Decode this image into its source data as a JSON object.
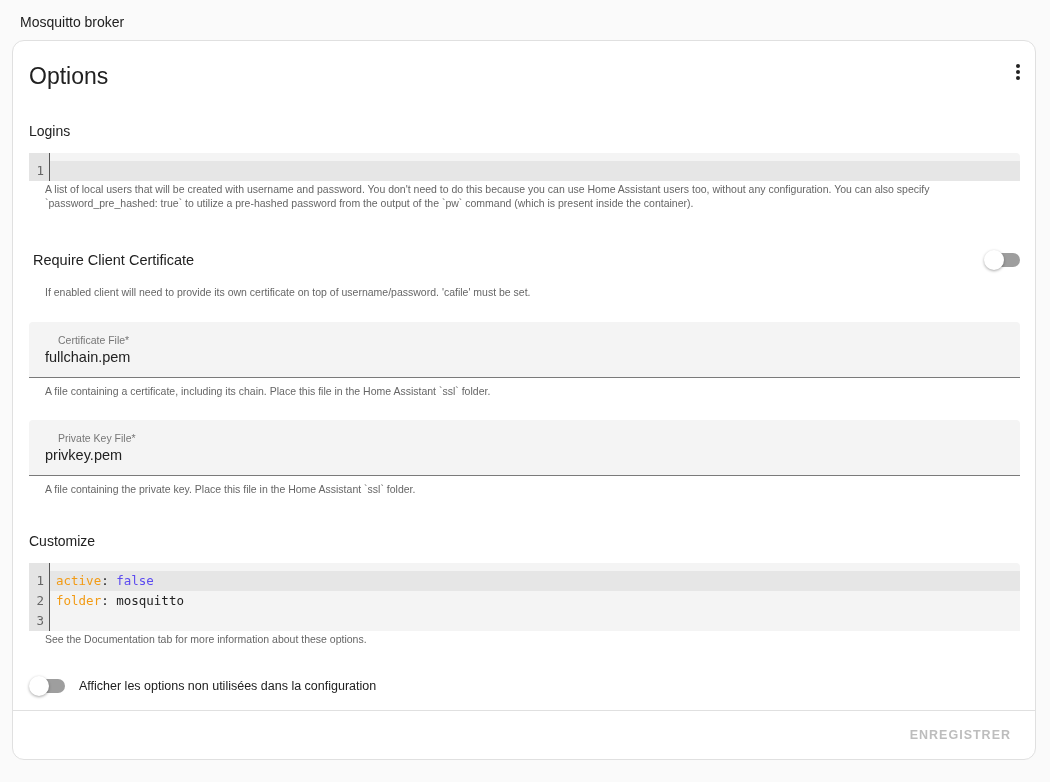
{
  "page_title": "Mosquitto broker",
  "card": {
    "title": "Options",
    "sections": [
      {
        "kind": "code_editor",
        "label": "Logins",
        "lines": [
          {
            "number": "1",
            "current": true
          }
        ],
        "helper": "A list of local users that will be created with username and password. You don't need to do this because you can use Home Assistant users too, without any configuration. You can also specify `password_pre_hashed: true` to utilize a pre-hashed password from the output of the `pw` command (which is present inside the container)."
      },
      {
        "kind": "toggle",
        "label": "Require Client Certificate",
        "on": false,
        "helper": "If enabled client will need to provide its own certificate on top of username/password. 'cafile' must be set."
      },
      {
        "kind": "text_field",
        "label": "Certificate File*",
        "value": "fullchain.pem",
        "helper": "A file containing a certificate, including its chain. Place this file in the Home Assistant `ssl` folder."
      },
      {
        "kind": "text_field",
        "label": "Private Key File*",
        "value": "privkey.pem",
        "helper": "A file containing the private key. Place this file in the Home Assistant `ssl` folder."
      },
      {
        "kind": "code_editor",
        "label": "Customize",
        "lines": [
          {
            "number": "1",
            "current": true,
            "tokens": [
              {
                "text": "active",
                "kind": "key"
              },
              {
                "text": ": ",
                "kind": "plain"
              },
              {
                "text": "false",
                "kind": "atom"
              }
            ]
          },
          {
            "number": "2",
            "current": false,
            "tokens": [
              {
                "text": "folder",
                "kind": "key"
              },
              {
                "text": ": ",
                "kind": "plain"
              },
              {
                "text": "mosquitto",
                "kind": "plain"
              }
            ]
          },
          {
            "number": "3",
            "current": false
          }
        ],
        "helper": "See the Documentation tab for more information about these options."
      }
    ],
    "unused_toggle": {
      "label": "Afficher les options non utilisées dans la configuration",
      "on": false
    },
    "save_button": {
      "label": "ENREGISTRER",
      "disabled": true
    }
  }
}
